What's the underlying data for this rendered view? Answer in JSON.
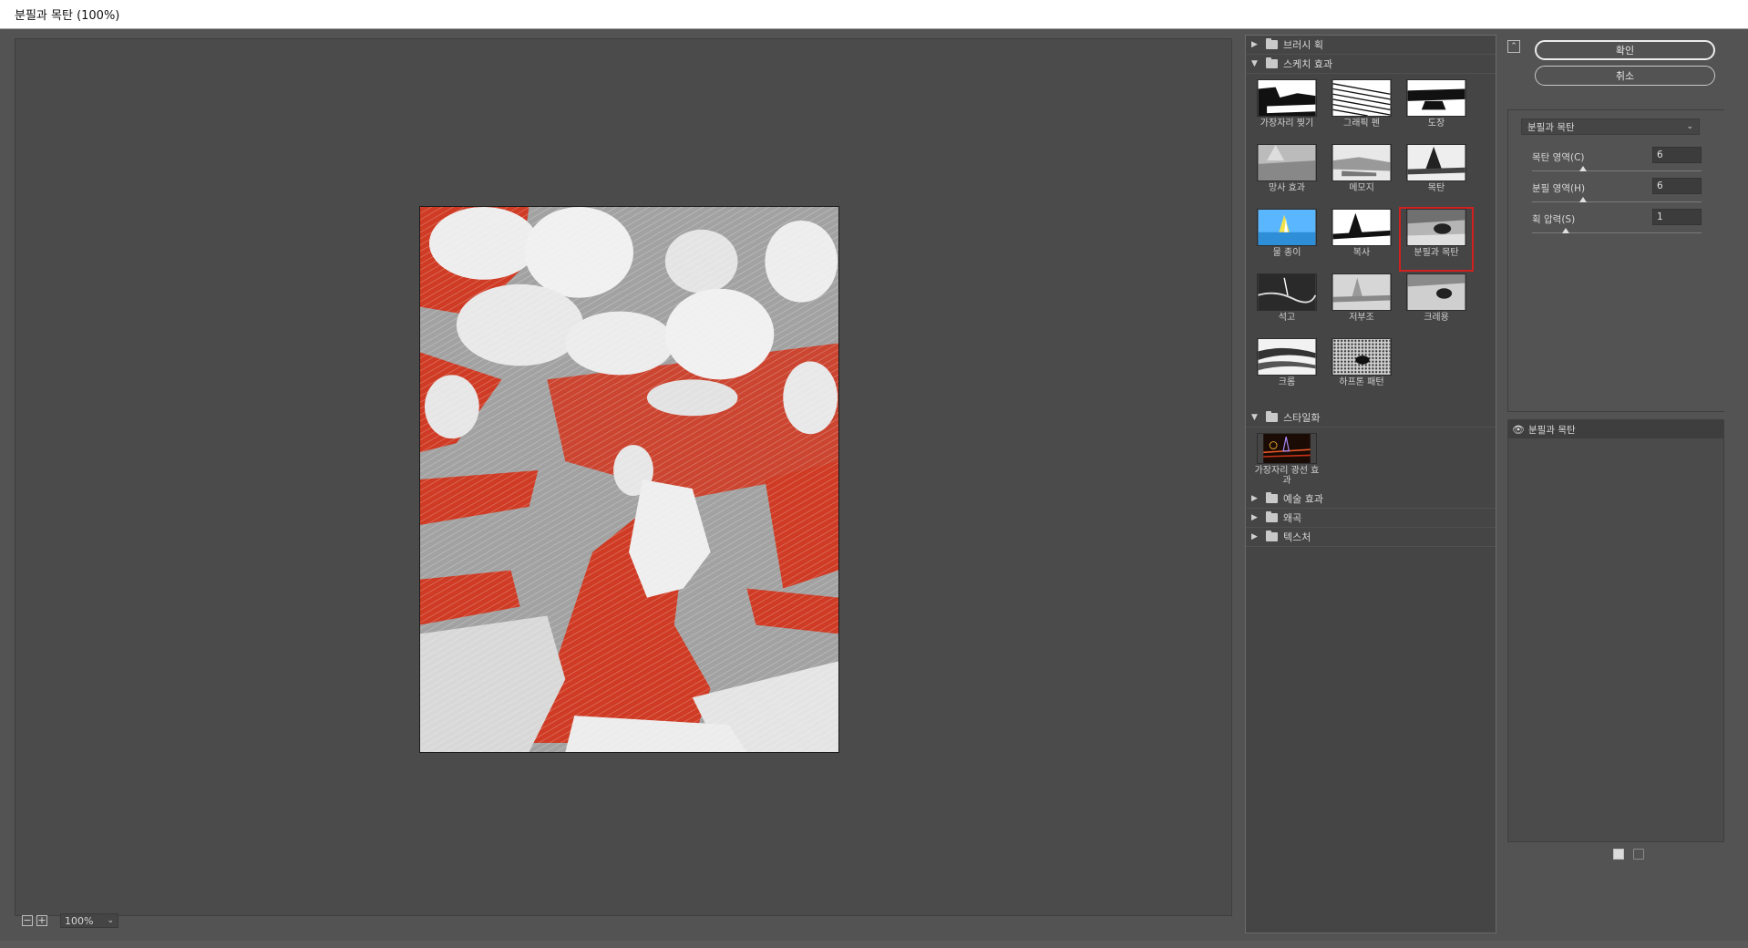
{
  "window": {
    "title": "분필과 목탄 (100%)"
  },
  "preview": {
    "zoom": "100%"
  },
  "gallery": {
    "folders": [
      {
        "name": "브러시 획",
        "expanded": false
      },
      {
        "name": "스케치 효과",
        "expanded": true,
        "items": [
          "가장자리 찢기",
          "그래픽 펜",
          "도장",
          "망사 효과",
          "메모지",
          "목탄",
          "물 종이",
          "복사",
          "분필과 목탄",
          "석고",
          "저부조",
          "크레용",
          "크롬",
          "하프톤 패턴"
        ],
        "selected": "분필과 목탄"
      },
      {
        "name": "스타일화",
        "expanded": true,
        "items": [
          "가장자리 광선 효과"
        ]
      },
      {
        "name": "예술 효과",
        "expanded": false
      },
      {
        "name": "왜곡",
        "expanded": false
      },
      {
        "name": "텍스처",
        "expanded": false
      }
    ]
  },
  "buttons": {
    "ok": "확인",
    "cancel": "취소"
  },
  "options": {
    "filter": "분필과 목탄",
    "params": [
      {
        "label": "목탄 영역(C)",
        "value": "6",
        "fraction": 0.3
      },
      {
        "label": "분필 영역(H)",
        "value": "6",
        "fraction": 0.3
      },
      {
        "label": "획 압력(S)",
        "value": "1",
        "fraction": 0.2
      }
    ]
  },
  "layers": [
    {
      "name": "분필과 목탄",
      "visible": true
    }
  ],
  "colors": {
    "accent_select": "#d21f1f",
    "effect_red": "#d33a23",
    "panel_bg": "#535353"
  }
}
